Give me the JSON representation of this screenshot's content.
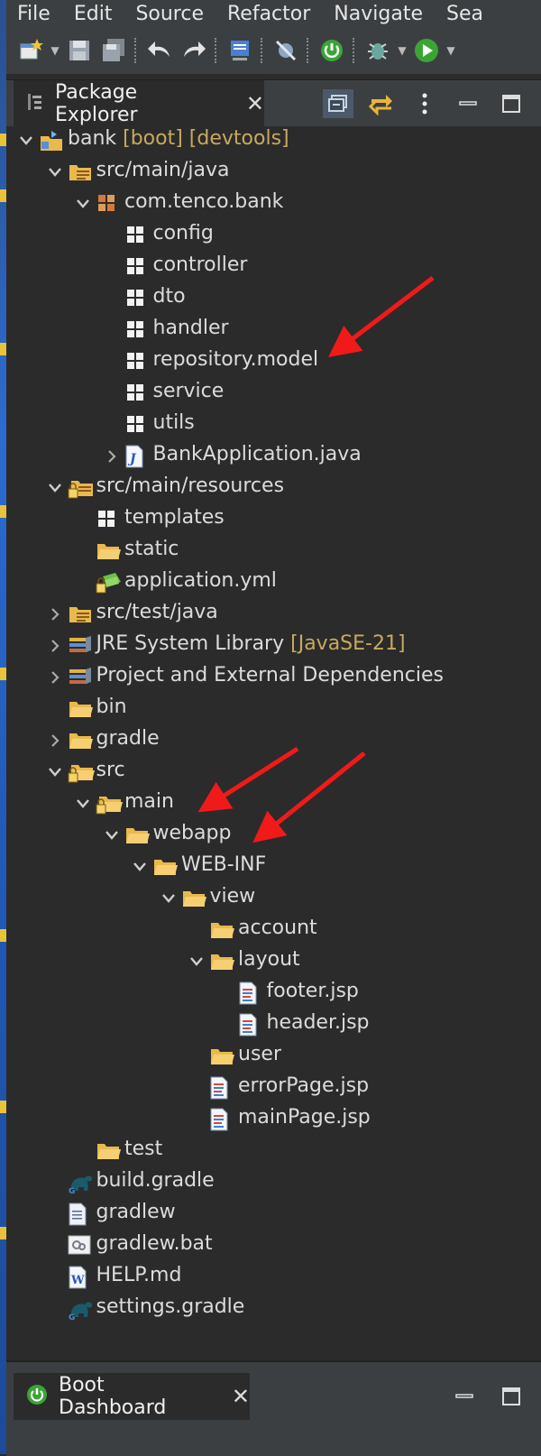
{
  "menubar": {
    "items": [
      "File",
      "Edit",
      "Source",
      "Refactor",
      "Navigate",
      "Sea"
    ]
  },
  "package_explorer": {
    "title": "Package Explorer",
    "tree": [
      {
        "label": "bank",
        "deco": " [boot] [devtools]",
        "depth": 0,
        "state": "open",
        "icon": "project-icon"
      },
      {
        "label": "src/main/java",
        "depth": 1,
        "state": "open",
        "icon": "source-folder-icon"
      },
      {
        "label": "com.tenco.bank",
        "depth": 2,
        "state": "open",
        "icon": "package-icon"
      },
      {
        "label": "config",
        "depth": 3,
        "state": "none",
        "icon": "package-empty-icon"
      },
      {
        "label": "controller",
        "depth": 3,
        "state": "none",
        "icon": "package-empty-icon"
      },
      {
        "label": "dto",
        "depth": 3,
        "state": "none",
        "icon": "package-empty-icon"
      },
      {
        "label": "handler",
        "depth": 3,
        "state": "none",
        "icon": "package-empty-icon"
      },
      {
        "label": "repository.model",
        "depth": 3,
        "state": "none",
        "icon": "package-empty-icon"
      },
      {
        "label": "service",
        "depth": 3,
        "state": "none",
        "icon": "package-empty-icon"
      },
      {
        "label": "utils",
        "depth": 3,
        "state": "none",
        "icon": "package-empty-icon"
      },
      {
        "label": "BankApplication.java",
        "depth": 3,
        "state": "closed",
        "icon": "java-file-icon"
      },
      {
        "label": "src/main/resources",
        "depth": 1,
        "state": "open",
        "icon": "source-folder-locked-icon"
      },
      {
        "label": "templates",
        "depth": 2,
        "state": "none",
        "icon": "package-empty-icon"
      },
      {
        "label": "static",
        "depth": 2,
        "state": "none",
        "icon": "folder-icon"
      },
      {
        "label": "application.yml",
        "depth": 2,
        "state": "none",
        "icon": "yml-file-icon"
      },
      {
        "label": "src/test/java",
        "depth": 1,
        "state": "closed",
        "icon": "source-folder-icon"
      },
      {
        "label": "JRE System Library",
        "deco": " [JavaSE-21]",
        "depth": 1,
        "state": "closed",
        "icon": "library-icon"
      },
      {
        "label": "Project and External Dependencies",
        "depth": 1,
        "state": "closed",
        "icon": "library-icon"
      },
      {
        "label": "bin",
        "depth": 1,
        "state": "none",
        "icon": "folder-icon"
      },
      {
        "label": "gradle",
        "depth": 1,
        "state": "closed",
        "icon": "folder-icon"
      },
      {
        "label": "src",
        "depth": 1,
        "state": "open",
        "icon": "folder-locked-icon"
      },
      {
        "label": "main",
        "depth": 2,
        "state": "open",
        "icon": "folder-locked-icon"
      },
      {
        "label": "webapp",
        "depth": 3,
        "state": "open",
        "icon": "folder-icon"
      },
      {
        "label": "WEB-INF",
        "depth": 4,
        "state": "open",
        "icon": "folder-icon"
      },
      {
        "label": "view",
        "depth": 5,
        "state": "open",
        "icon": "folder-icon"
      },
      {
        "label": "account",
        "depth": 6,
        "state": "none",
        "icon": "folder-icon"
      },
      {
        "label": "layout",
        "depth": 6,
        "state": "open",
        "icon": "folder-icon"
      },
      {
        "label": "footer.jsp",
        "depth": 7,
        "state": "none",
        "icon": "jsp-file-icon"
      },
      {
        "label": "header.jsp",
        "depth": 7,
        "state": "none",
        "icon": "jsp-file-icon"
      },
      {
        "label": "user",
        "depth": 6,
        "state": "none",
        "icon": "folder-icon"
      },
      {
        "label": "errorPage.jsp",
        "depth": 6,
        "state": "none",
        "icon": "jsp-file-icon"
      },
      {
        "label": "mainPage.jsp",
        "depth": 6,
        "state": "none",
        "icon": "jsp-file-icon"
      },
      {
        "label": "test",
        "depth": 2,
        "state": "none",
        "icon": "folder-icon"
      },
      {
        "label": "build.gradle",
        "depth": 1,
        "state": "none",
        "icon": "gradle-file-icon"
      },
      {
        "label": "gradlew",
        "depth": 1,
        "state": "none",
        "icon": "text-file-icon"
      },
      {
        "label": "gradlew.bat",
        "depth": 1,
        "state": "none",
        "icon": "bat-file-icon"
      },
      {
        "label": "HELP.md",
        "depth": 1,
        "state": "none",
        "icon": "md-file-icon"
      },
      {
        "label": "settings.gradle",
        "depth": 1,
        "state": "none",
        "icon": "gradle-file-icon"
      }
    ]
  },
  "boot_dashboard": {
    "title": "Boot Dashboard"
  },
  "annotations": {
    "arrow_color": "#f01a1a"
  },
  "colors": {
    "background": "#2b2b2b",
    "chrome": "#3c3f41",
    "decoration_text": "#c8a95f",
    "folder": "#e9b94e"
  }
}
